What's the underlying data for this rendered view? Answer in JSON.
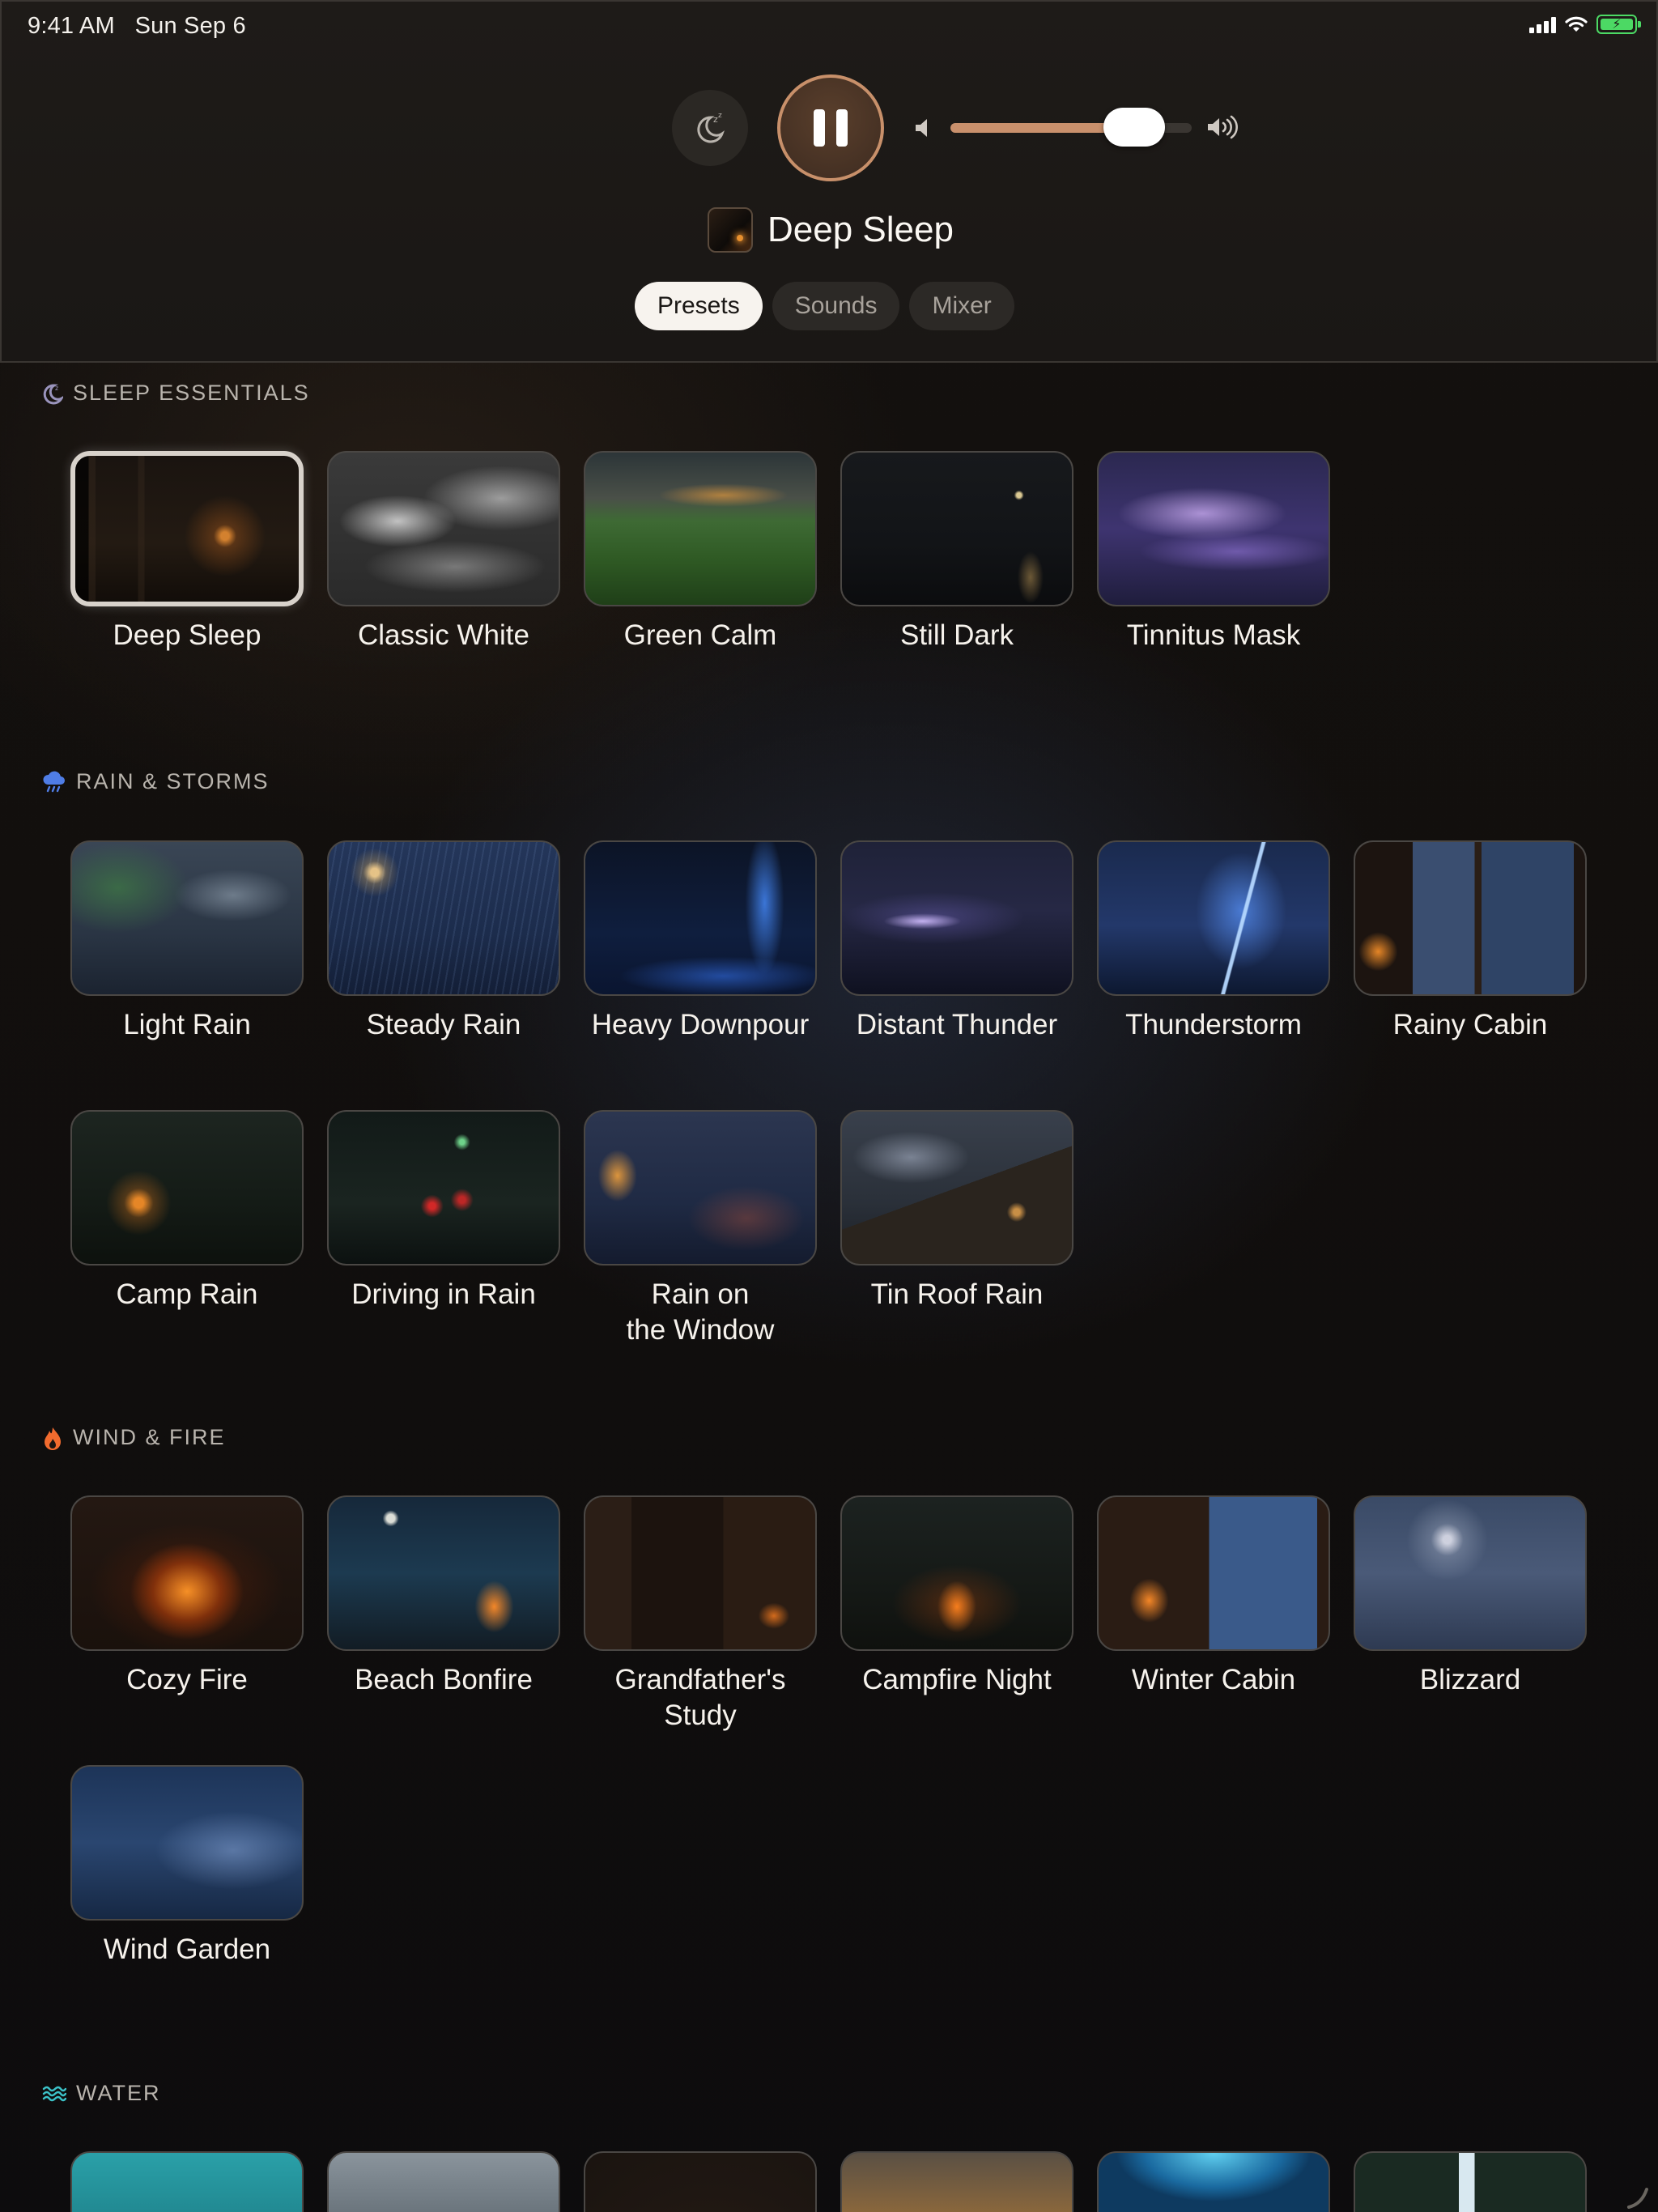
{
  "status": {
    "time": "9:41 AM",
    "date": "Sun Sep 6"
  },
  "player": {
    "volume": 0.748,
    "now_playing": "Deep Sleep",
    "state": "playing"
  },
  "tabs": [
    {
      "label": "Presets",
      "active": true
    },
    {
      "label": "Sounds",
      "active": false
    },
    {
      "label": "Mixer",
      "active": false
    }
  ],
  "sections": {
    "sleep": {
      "title": "SLEEP ESSENTIALS",
      "items": [
        "Deep Sleep",
        "Classic White",
        "Green Calm",
        "Still Dark",
        "Tinnitus Mask"
      ]
    },
    "rain": {
      "title": "RAIN & STORMS",
      "items": [
        "Light Rain",
        "Steady Rain",
        "Heavy Downpour",
        "Distant Thunder",
        "Thunderstorm",
        "Rainy Cabin",
        "Camp Rain",
        "Driving in Rain",
        "Rain on\nthe Window",
        "Tin Roof Rain"
      ]
    },
    "fire": {
      "title": "WIND & FIRE",
      "items": [
        "Cozy Fire",
        "Beach Bonfire",
        "Grandfather's\nStudy",
        "Campfire Night",
        "Winter Cabin",
        "Blizzard",
        "Wind Garden"
      ]
    },
    "water": {
      "title": "WATER"
    }
  },
  "colors": {
    "accent": "#c9906c",
    "selected_border": "#d8d2cb",
    "background": "#120f0d"
  }
}
